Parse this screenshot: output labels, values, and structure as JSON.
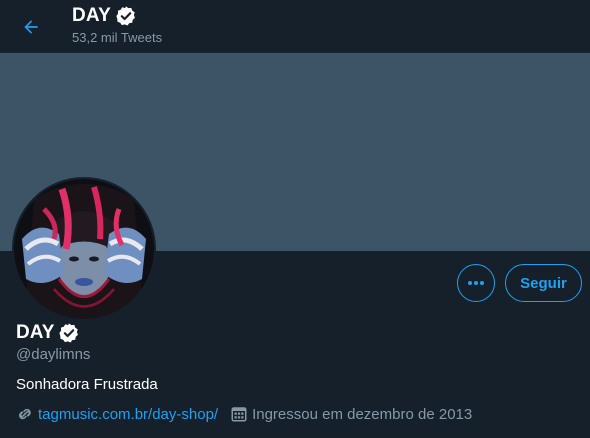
{
  "header": {
    "title": "DAY",
    "subtitle": "53,2 mil Tweets",
    "back_icon": "arrow-left-icon",
    "verified_icon": "verified-badge-icon"
  },
  "profile": {
    "name": "DAY",
    "handle": "@daylimns",
    "bio": "Sonhadora Frustrada",
    "website": "tagmusic.com.br/day-shop/",
    "joined": "Ingressou em dezembro de 2013",
    "link_icon": "link-icon",
    "calendar_icon": "calendar-icon"
  },
  "actions": {
    "more_icon": "more-dots-icon",
    "follow_label": "Seguir"
  },
  "colors": {
    "background": "#15202b",
    "banner": "#3d5466",
    "accent": "#1da1f2",
    "secondary_text": "#8899a6"
  }
}
